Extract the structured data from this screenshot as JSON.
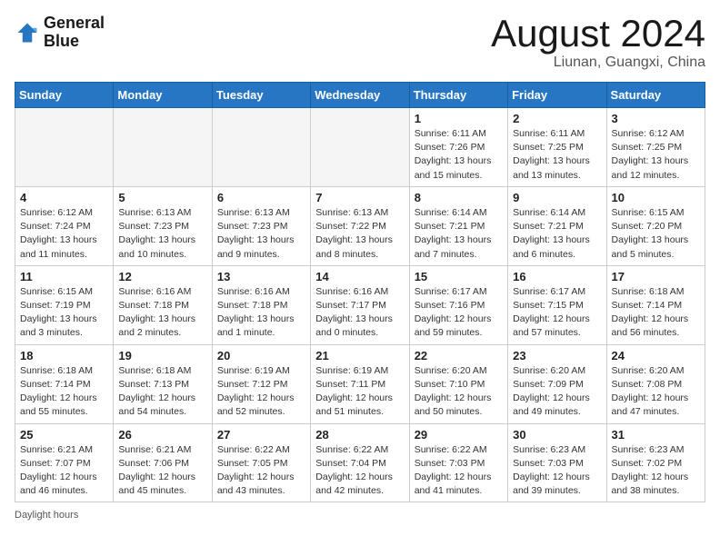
{
  "header": {
    "logo_line1": "General",
    "logo_line2": "Blue",
    "month_year": "August 2024",
    "location": "Liunan, Guangxi, China"
  },
  "days_of_week": [
    "Sunday",
    "Monday",
    "Tuesday",
    "Wednesday",
    "Thursday",
    "Friday",
    "Saturday"
  ],
  "weeks": [
    [
      {
        "day": null
      },
      {
        "day": null
      },
      {
        "day": null
      },
      {
        "day": null
      },
      {
        "day": "1",
        "sunrise": "6:11 AM",
        "sunset": "7:26 PM",
        "daylight": "13 hours and 15 minutes."
      },
      {
        "day": "2",
        "sunrise": "6:11 AM",
        "sunset": "7:25 PM",
        "daylight": "13 hours and 13 minutes."
      },
      {
        "day": "3",
        "sunrise": "6:12 AM",
        "sunset": "7:25 PM",
        "daylight": "13 hours and 12 minutes."
      }
    ],
    [
      {
        "day": "4",
        "sunrise": "6:12 AM",
        "sunset": "7:24 PM",
        "daylight": "13 hours and 11 minutes."
      },
      {
        "day": "5",
        "sunrise": "6:13 AM",
        "sunset": "7:23 PM",
        "daylight": "13 hours and 10 minutes."
      },
      {
        "day": "6",
        "sunrise": "6:13 AM",
        "sunset": "7:23 PM",
        "daylight": "13 hours and 9 minutes."
      },
      {
        "day": "7",
        "sunrise": "6:13 AM",
        "sunset": "7:22 PM",
        "daylight": "13 hours and 8 minutes."
      },
      {
        "day": "8",
        "sunrise": "6:14 AM",
        "sunset": "7:21 PM",
        "daylight": "13 hours and 7 minutes."
      },
      {
        "day": "9",
        "sunrise": "6:14 AM",
        "sunset": "7:21 PM",
        "daylight": "13 hours and 6 minutes."
      },
      {
        "day": "10",
        "sunrise": "6:15 AM",
        "sunset": "7:20 PM",
        "daylight": "13 hours and 5 minutes."
      }
    ],
    [
      {
        "day": "11",
        "sunrise": "6:15 AM",
        "sunset": "7:19 PM",
        "daylight": "13 hours and 3 minutes."
      },
      {
        "day": "12",
        "sunrise": "6:16 AM",
        "sunset": "7:18 PM",
        "daylight": "13 hours and 2 minutes."
      },
      {
        "day": "13",
        "sunrise": "6:16 AM",
        "sunset": "7:18 PM",
        "daylight": "13 hours and 1 minute."
      },
      {
        "day": "14",
        "sunrise": "6:16 AM",
        "sunset": "7:17 PM",
        "daylight": "13 hours and 0 minutes."
      },
      {
        "day": "15",
        "sunrise": "6:17 AM",
        "sunset": "7:16 PM",
        "daylight": "12 hours and 59 minutes."
      },
      {
        "day": "16",
        "sunrise": "6:17 AM",
        "sunset": "7:15 PM",
        "daylight": "12 hours and 57 minutes."
      },
      {
        "day": "17",
        "sunrise": "6:18 AM",
        "sunset": "7:14 PM",
        "daylight": "12 hours and 56 minutes."
      }
    ],
    [
      {
        "day": "18",
        "sunrise": "6:18 AM",
        "sunset": "7:14 PM",
        "daylight": "12 hours and 55 minutes."
      },
      {
        "day": "19",
        "sunrise": "6:18 AM",
        "sunset": "7:13 PM",
        "daylight": "12 hours and 54 minutes."
      },
      {
        "day": "20",
        "sunrise": "6:19 AM",
        "sunset": "7:12 PM",
        "daylight": "12 hours and 52 minutes."
      },
      {
        "day": "21",
        "sunrise": "6:19 AM",
        "sunset": "7:11 PM",
        "daylight": "12 hours and 51 minutes."
      },
      {
        "day": "22",
        "sunrise": "6:20 AM",
        "sunset": "7:10 PM",
        "daylight": "12 hours and 50 minutes."
      },
      {
        "day": "23",
        "sunrise": "6:20 AM",
        "sunset": "7:09 PM",
        "daylight": "12 hours and 49 minutes."
      },
      {
        "day": "24",
        "sunrise": "6:20 AM",
        "sunset": "7:08 PM",
        "daylight": "12 hours and 47 minutes."
      }
    ],
    [
      {
        "day": "25",
        "sunrise": "6:21 AM",
        "sunset": "7:07 PM",
        "daylight": "12 hours and 46 minutes."
      },
      {
        "day": "26",
        "sunrise": "6:21 AM",
        "sunset": "7:06 PM",
        "daylight": "12 hours and 45 minutes."
      },
      {
        "day": "27",
        "sunrise": "6:22 AM",
        "sunset": "7:05 PM",
        "daylight": "12 hours and 43 minutes."
      },
      {
        "day": "28",
        "sunrise": "6:22 AM",
        "sunset": "7:04 PM",
        "daylight": "12 hours and 42 minutes."
      },
      {
        "day": "29",
        "sunrise": "6:22 AM",
        "sunset": "7:03 PM",
        "daylight": "12 hours and 41 minutes."
      },
      {
        "day": "30",
        "sunrise": "6:23 AM",
        "sunset": "7:03 PM",
        "daylight": "12 hours and 39 minutes."
      },
      {
        "day": "31",
        "sunrise": "6:23 AM",
        "sunset": "7:02 PM",
        "daylight": "12 hours and 38 minutes."
      }
    ]
  ],
  "footer": {
    "daylight_label": "Daylight hours"
  }
}
